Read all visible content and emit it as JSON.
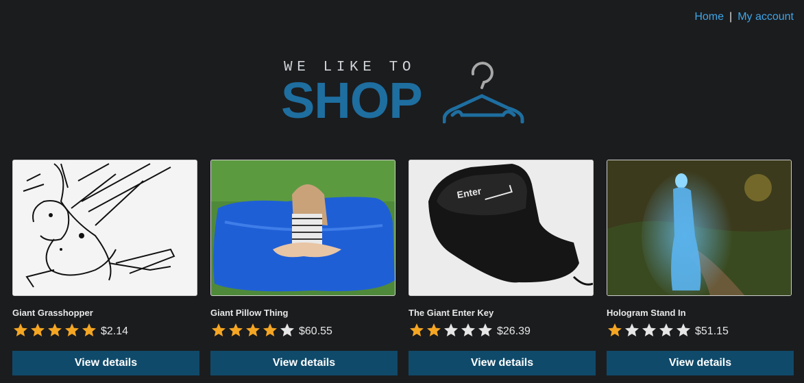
{
  "nav": {
    "home": "Home",
    "separator": "|",
    "account": "My account"
  },
  "logo": {
    "tagline": "WE LIKE TO",
    "word": "SHOP",
    "color": "#1e6ea0",
    "icon": "hanger-icon"
  },
  "colors": {
    "link": "#3fa6e8",
    "button": "#104a6a",
    "star_filled": "#f5a623",
    "star_empty": "#e6e6e6"
  },
  "products": [
    {
      "name": "Giant Grasshopper",
      "rating": 5,
      "price": "$2.14",
      "button": "View details",
      "image": "grasshopper-sketch"
    },
    {
      "name": "Giant Pillow Thing",
      "rating": 4,
      "price": "$60.55",
      "button": "View details",
      "image": "blue-pillow-with-girl"
    },
    {
      "name": "The Giant Enter Key",
      "rating": 2,
      "price": "$26.39",
      "button": "View details",
      "image": "enter-key-cushion",
      "key_label": "Enter"
    },
    {
      "name": "Hologram Stand In",
      "rating": 1,
      "price": "$51.15",
      "button": "View details",
      "image": "hologram-woman-in-park"
    }
  ]
}
